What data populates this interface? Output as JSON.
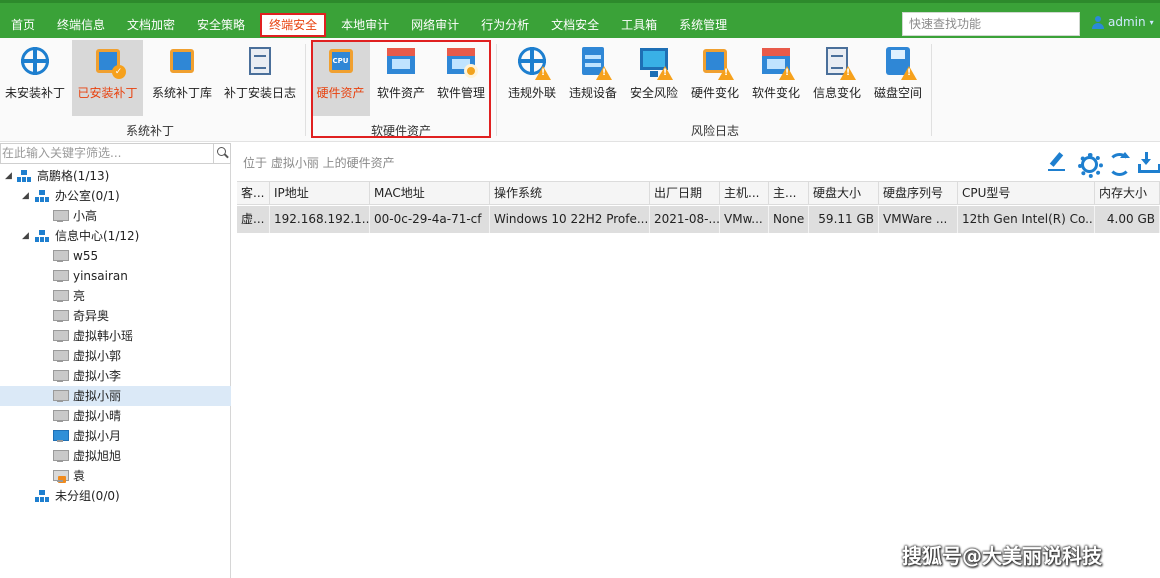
{
  "menu": {
    "tabs": [
      "首页",
      "终端信息",
      "文档加密",
      "安全策略",
      "终端安全",
      "本地审计",
      "网络审计",
      "行为分析",
      "文档安全",
      "工具箱",
      "系统管理"
    ],
    "active_tab": "终端安全",
    "search_placeholder": "快速查找功能",
    "user": "admin"
  },
  "ribbon": {
    "buttons": [
      "未安装补丁",
      "已安装补丁",
      "系统补丁库",
      "补丁安装日志",
      "硬件资产",
      "软件资产",
      "软件管理",
      "违规外联",
      "违规设备",
      "安全风险",
      "硬件变化",
      "软件变化",
      "信息变化",
      "磁盘空间"
    ],
    "groups": [
      "系统补丁",
      "软硬件资产",
      "风险日志"
    ],
    "chip_text": "CPU"
  },
  "tree": {
    "filter_placeholder": "在此输入关键字筛选...",
    "nodes": [
      "高鹏格(1/13)",
      "办公室(0/1)",
      "小高",
      "信息中心(1/12)",
      "w55",
      "yinsairan",
      "亮",
      "奇异奥",
      "虚拟韩小瑶",
      "虚拟小郭",
      "虚拟小李",
      "虚拟小丽",
      "虚拟小晴",
      "虚拟小月",
      "虚拟旭旭",
      "袁",
      "未分组(0/0)"
    ]
  },
  "main": {
    "location": "位于 虚拟小丽 上的硬件资产",
    "columns": [
      "客...",
      "IP地址",
      "MAC地址",
      "操作系统",
      "出厂日期",
      "主机...",
      "主...",
      "硬盘大小",
      "硬盘序列号",
      "CPU型号",
      "内存大小"
    ],
    "rows": [
      [
        "虚...",
        "192.168.192.1...",
        "00-0c-29-4a-71-cf",
        "Windows 10 22H2 Profe...",
        "2021-08-...",
        "VMw...",
        "None",
        "59.11 GB",
        "VMWare ...",
        "12th Gen Intel(R) Co...",
        "4.00 GB"
      ]
    ]
  },
  "watermark": "搜狐号@大美丽说科技"
}
